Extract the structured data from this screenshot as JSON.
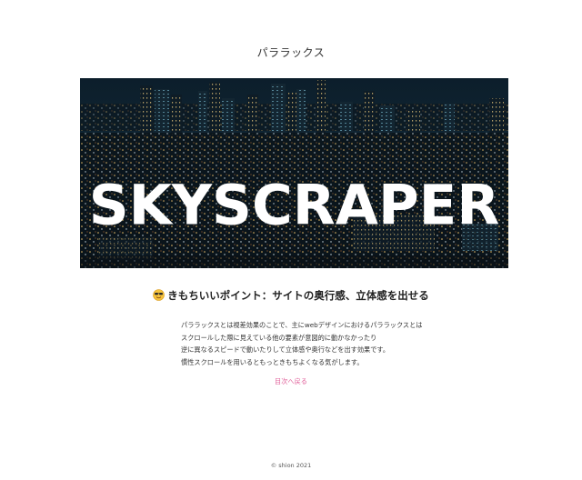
{
  "header": {
    "title": "パララックス"
  },
  "hero": {
    "overlay_text": "SKYSCRAPER"
  },
  "section": {
    "emoji_icon": "smiling-face-with-sunglasses-icon",
    "heading": "きもちいいポイント：サイトの奥行感、立体感を出せる",
    "paragraphs": [
      "パララックスとは視差効果のことで、主にwebデザインにおけるパララックスとは",
      "スクロールした際に見えている他の要素が意図的に動かなかったり",
      "逆に異なるスピードで動いたりして立体感や奥行などを出す効果です。",
      "慣性スクロールを用いるともっときもちよくなる気がします。"
    ],
    "back_link": "目次へ戻る"
  },
  "footer": {
    "copyright": "© shion 2021"
  },
  "colors": {
    "link": "#e0609a",
    "hero_sky": "#0b1822",
    "text": "#333333"
  }
}
